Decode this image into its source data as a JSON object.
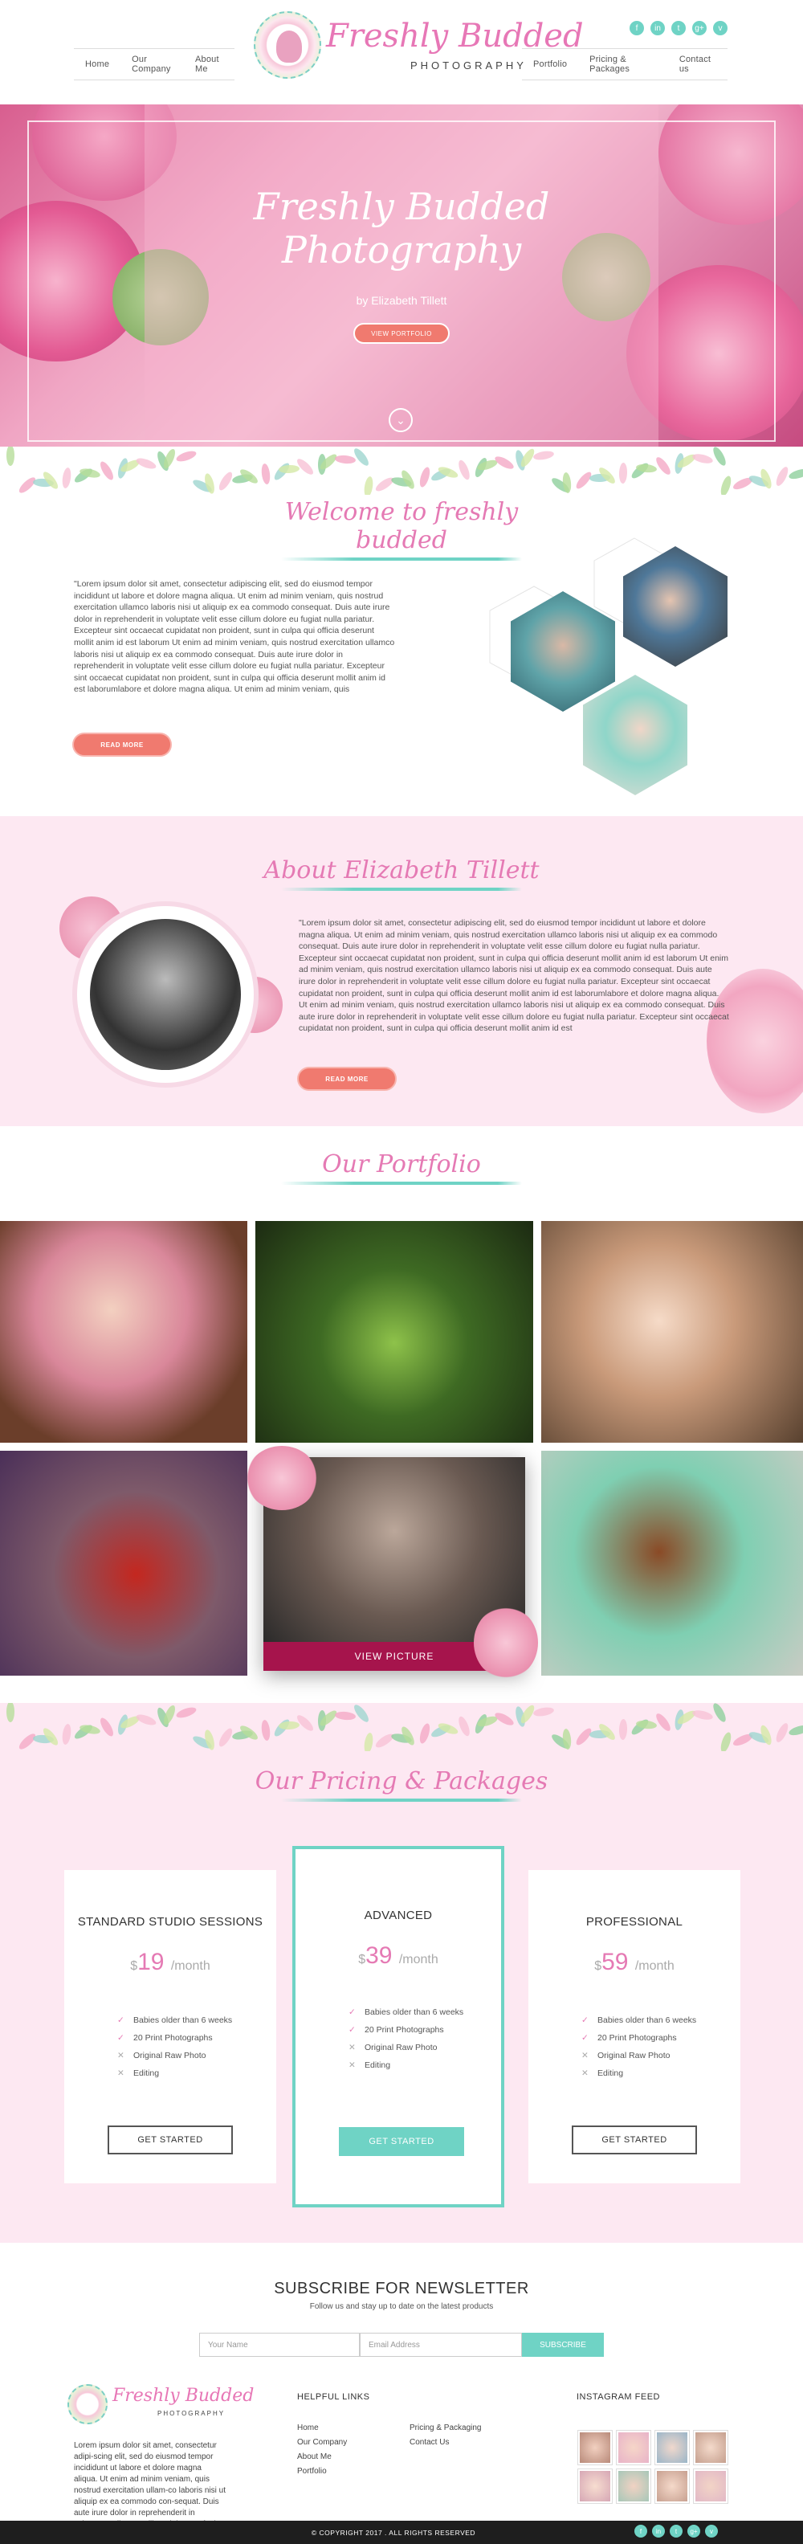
{
  "nav": {
    "left": [
      "Home",
      "Our Company",
      "About Me"
    ],
    "right": [
      "Portfolio",
      "Pricing & Packages",
      "Contact us"
    ]
  },
  "logo": {
    "name": "Freshly Budded",
    "sub": "PHOTOGRAPHY"
  },
  "social_icons": [
    "facebook-icon",
    "linkedin-icon",
    "twitter-icon",
    "google-plus-icon",
    "vine-icon"
  ],
  "social_glyphs": [
    "f",
    "in",
    "t",
    "g+",
    "v"
  ],
  "hero": {
    "title": "Freshly Budded Photography",
    "byline": "by Elizabeth Tillett",
    "button": "VIEW PORTFOLIO",
    "down": "⌄"
  },
  "welcome": {
    "heading": "Welcome to freshly budded",
    "text": "\"Lorem ipsum dolor sit amet, consectetur adipiscing elit, sed do eiusmod tempor incididunt ut labore et dolore magna aliqua. Ut enim ad minim veniam, quis nostrud exercitation ullamco laboris nisi ut aliquip ex ea commodo consequat. Duis aute irure dolor in reprehenderit in voluptate velit esse cillum dolore eu fugiat nulla pariatur. Excepteur sint occaecat cupidatat non proident, sunt in culpa qui officia deserunt mollit anim id est laborum Ut enim ad minim veniam, quis nostrud exercitation ullamco laboris nisi ut aliquip ex ea commodo consequat. Duis aute irure dolor in reprehenderit in voluptate velit esse cillum dolore eu fugiat nulla pariatur. Excepteur sint occaecat cupidatat non proident, sunt in culpa qui officia deserunt mollit anim id est laborumlabore et dolore magna aliqua. Ut enim ad minim veniam, quis",
    "button": "READ MORE"
  },
  "about": {
    "heading": "About Elizabeth Tillett",
    "text": "\"Lorem ipsum dolor sit amet, consectetur adipiscing elit, sed do eiusmod tempor incididunt ut labore et dolore magna aliqua. Ut enim ad minim veniam, quis nostrud exercitation ullamco laboris nisi ut aliquip ex ea commodo consequat. Duis aute irure dolor in reprehenderit in voluptate velit esse cillum dolore eu fugiat nulla pariatur. Excepteur sint occaecat cupidatat non proident, sunt in culpa qui officia deserunt mollit anim id est laborum Ut enim ad minim veniam, quis nostrud exercitation ullamco laboris nisi ut aliquip ex ea commodo consequat. Duis aute irure dolor in reprehenderit in voluptate velit esse cillum dolore eu fugiat nulla pariatur. Excepteur sint occaecat cupidatat non proident, sunt in culpa qui officia deserunt mollit anim id est laborumlabore et dolore magna aliqua. Ut enim ad minim veniam, quis nostrud exercitation ullamco laboris nisi ut aliquip ex ea commodo consequat. Duis aute irure dolor in reprehenderit in voluptate velit esse cillum dolore eu fugiat nulla pariatur. Excepteur sint occaecat cupidatat non proident, sunt in culpa qui officia deserunt mollit anim id est",
    "button": "READ MORE"
  },
  "portfolio": {
    "heading": "Our Portfolio",
    "featured_label": "VIEW PICTURE"
  },
  "pricing": {
    "heading": "Our Pricing & Packages",
    "plans": [
      {
        "name": "STANDARD STUDIO SESSIONS",
        "currency": "$",
        "price": "19",
        "period": "/month",
        "button": "GET STARTED"
      },
      {
        "name": "ADVANCED",
        "currency": "$",
        "price": "39",
        "period": "/month",
        "button": "GET STARTED"
      },
      {
        "name": "PROFESSIONAL",
        "currency": "$",
        "price": "59",
        "period": "/month",
        "button": "GET STARTED"
      }
    ],
    "features": [
      "Babies older than 6 weeks",
      "20 Print Photographs",
      "Original Raw Photo",
      "Editing"
    ],
    "check": "✓",
    "cross": "✕"
  },
  "newsletter": {
    "title": "SUBSCRIBE FOR NEWSLETTER",
    "subtitle": "Follow us and stay up to date on the latest products",
    "name_placeholder": "Your Name",
    "email_placeholder": "Email Address",
    "button": "SUBSCRIBE"
  },
  "footer": {
    "about": "Lorem ipsum dolor sit amet, consectetur adipi-scing elit, sed do eiusmod tempor incididunt ut labore et dolore magna aliqua. Ut enim ad minim veniam, quis nostrud exercitation ullam-co laboris nisi ut aliquip ex ea commodo con-sequat. Duis aute irure dolor in reprehenderit in voluptate velit esse cillum dolore eu fugiat nulla pariatur.",
    "helpful_title": "HELPFUL LINKS",
    "links_col1": [
      "Home",
      "Our Company",
      "About Me",
      "Portfolio"
    ],
    "links_col2": [
      "Pricing & Packaging",
      "Contact Us"
    ],
    "instagram_title": "INSTAGRAM FEED",
    "copyright": "© COPYRIGHT 2017 . ALL RIGHTS RESERVED"
  },
  "colors": {
    "pink": "#e57ab4",
    "teal": "#6fd3c5",
    "coral": "#f07a6f",
    "blush": "#fde8f2",
    "maroon": "#a6144c"
  }
}
